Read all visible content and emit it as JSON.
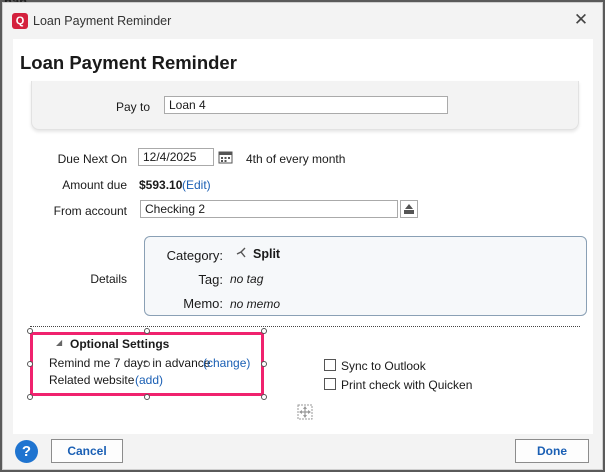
{
  "background": {
    "partial_text": "nan"
  },
  "window": {
    "title": "Loan Payment Reminder",
    "app_icon": "Q"
  },
  "heading": "Loan Payment Reminder",
  "form": {
    "pay_to": {
      "label": "Pay to",
      "value": "Loan 4"
    },
    "due_next_on": {
      "label": "Due Next On",
      "value": "12/4/2025",
      "frequency": "4th of every month"
    },
    "amount_due": {
      "label": "Amount due",
      "value": "$593.10",
      "edit_link": "(Edit)"
    },
    "from_account": {
      "label": "From account",
      "value": "Checking 2"
    },
    "details": {
      "label": "Details",
      "category_label": "Category:",
      "category_value": "Split",
      "tag_label": "Tag:",
      "tag_value": "no tag",
      "memo_label": "Memo:",
      "memo_value": "no memo"
    }
  },
  "optional_settings": {
    "title": "Optional Settings",
    "remind_text": "Remind me 7 days in advance",
    "remind_link": "(change)",
    "website_text": "Related website",
    "website_link": "(add)",
    "sync_outlook": {
      "label": "Sync to Outlook",
      "checked": false
    },
    "print_check": {
      "label": "Print check with Quicken",
      "checked": false
    }
  },
  "footer": {
    "help": "?",
    "cancel": "Cancel",
    "done": "Done"
  },
  "colors": {
    "accent": "#f0226e",
    "link": "#1a5fb4",
    "help": "#1f74d0",
    "brand": "#d4213d"
  }
}
